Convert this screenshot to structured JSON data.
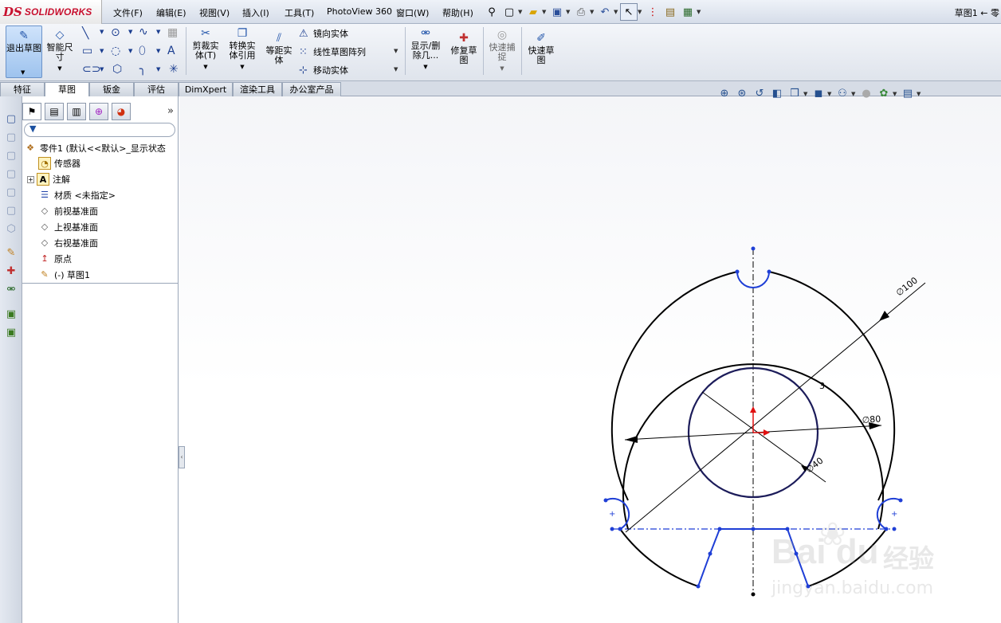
{
  "app": {
    "logo_mark": "DS",
    "logo_text": "SOLIDWORKS",
    "title": "草图1 ← 零"
  },
  "menu": [
    "文件(F)",
    "编辑(E)",
    "视图(V)",
    "插入(I)",
    "工具(T)",
    "PhotoView 360",
    "窗口(W)",
    "帮助(H)"
  ],
  "quick_access_icons": [
    "pin-icon",
    "new-document-icon",
    "open-folder-icon",
    "save-icon",
    "print-icon",
    "undo-icon",
    "select-arrow-icon",
    "traffic-light-icon",
    "file-properties-icon",
    "options-icon"
  ],
  "command_manager": {
    "exit_sketch": "退出草图",
    "smart_dimension": "智能尺寸",
    "trim": "剪裁实体(T)",
    "convert": "转换实体引用",
    "offset": "等距实体",
    "mirror": "镜向实体",
    "linear_pattern": "线性草图阵列",
    "move": "移动实体",
    "display_delete": "显示/删除几...",
    "repair": "修复草图",
    "quick_snaps": "快速捕捉",
    "rapid_sketch": "快速草图"
  },
  "tabs": [
    "特征",
    "草图",
    "钣金",
    "评估",
    "DimXpert",
    "渲染工具",
    "办公室产品"
  ],
  "active_tab": "草图",
  "feature_tree": {
    "root": "零件1 (默认<<默认>_显示状态",
    "items": [
      "传感器",
      "注解",
      "材质 <未指定>",
      "前视基准面",
      "上视基准面",
      "右视基准面",
      "原点",
      "(-) 草图1"
    ]
  },
  "sketch": {
    "dim_outer": "∅100",
    "dim_mid": "∅80",
    "dim_inner": "∅40",
    "dim_small": "3"
  },
  "watermark": {
    "brand": "Bai du",
    "cn": "经验",
    "url": "jingyan.baidu.com"
  },
  "colors": {
    "accent_blue": "#1f3fd6",
    "sketch_black": "#000000",
    "logo_red": "#c8102e"
  }
}
